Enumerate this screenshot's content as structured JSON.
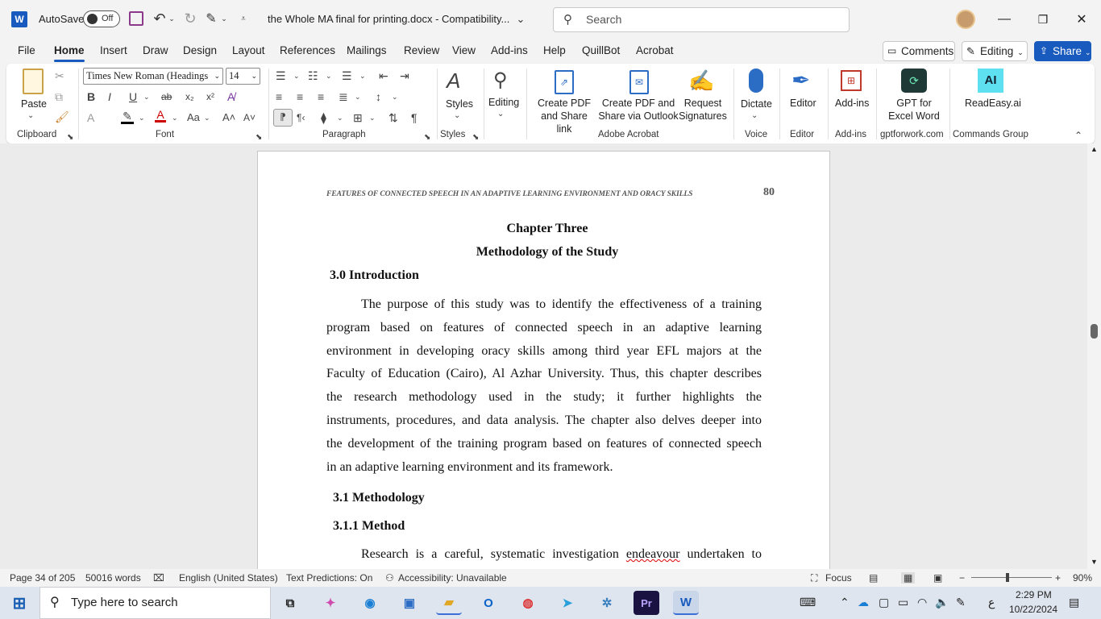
{
  "titlebar": {
    "autosave_label": "AutoSave",
    "autosave_state": "Off",
    "doc_title": "the Whole MA final for printing.docx  -  Compatibility...",
    "search_placeholder": "Search"
  },
  "menu": [
    "File",
    "Home",
    "Insert",
    "Draw",
    "Design",
    "Layout",
    "References",
    "Mailings",
    "Review",
    "View",
    "Add-ins",
    "Help",
    "QuillBot",
    "Acrobat"
  ],
  "topbuttons": {
    "comments": "Comments",
    "editing": "Editing",
    "share": "Share"
  },
  "ribbon": {
    "clipboard": {
      "paste": "Paste",
      "label": "Clipboard"
    },
    "font": {
      "name": "Times New Roman (Headings",
      "size": "14",
      "label": "Font"
    },
    "paragraph": {
      "label": "Paragraph"
    },
    "styles": {
      "btn": "Styles",
      "label": "Styles"
    },
    "editing": {
      "btn": "Editing"
    },
    "acrobat": {
      "b1_l1": "Create PDF",
      "b1_l2": "and Share link",
      "b2_l1": "Create PDF and",
      "b2_l2": "Share via Outlook",
      "b3_l1": "Request",
      "b3_l2": "Signatures",
      "label": "Adobe Acrobat"
    },
    "voice": {
      "btn": "Dictate",
      "label": "Voice"
    },
    "editor": {
      "btn": "Editor",
      "label": "Editor"
    },
    "addins": {
      "btn": "Add-ins",
      "label": "Add-ins"
    },
    "gpt": {
      "l1": "GPT for",
      "l2": "Excel Word",
      "label": "gptforwork.com"
    },
    "readeasy": {
      "btn": "ReadEasy.ai",
      "label": "Commands Group"
    }
  },
  "document": {
    "header": "FEATURES OF CONNECTED SPEECH IN AN ADAPTIVE LEARNING ENVIRONMENT AND ORACY SKILLS",
    "page_number": "80",
    "chapter": "Chapter Three",
    "chapter_title": "Methodology of the Study",
    "h30": "3.0 Introduction",
    "para1": [
      "The purpose of this study was to identify the effectiveness of a training",
      "program based on features of connected speech in an adaptive learning",
      "environment in developing oracy skills among third year EFL majors at the",
      "Faculty of Education (Cairo), Al Azhar University. Thus, this chapter describes",
      "the research methodology used in the study; it further highlights the",
      "instruments, procedures, and data analysis. The chapter also delves deeper into",
      "the development of the training program based on features of connected speech"
    ],
    "para1_last": "in an adaptive learning environment and its framework.",
    "h31": "3.1 Methodology",
    "h311": "3.1.1 Method",
    "para2_a": "Research is a careful, systematic investigation ",
    "para2_squig": "endeavour",
    "para2_b": " undertaken to"
  },
  "status": {
    "page": "Page 34 of 205",
    "words": "50016 words",
    "lang": "English (United States)",
    "predictions": "Text Predictions: On",
    "accessibility": "Accessibility: Unavailable",
    "focus": "Focus",
    "zoom": "90%"
  },
  "taskbar": {
    "search": "Type here to search",
    "time": "2:29 PM",
    "date": "10/22/2024",
    "lang": "ع"
  }
}
